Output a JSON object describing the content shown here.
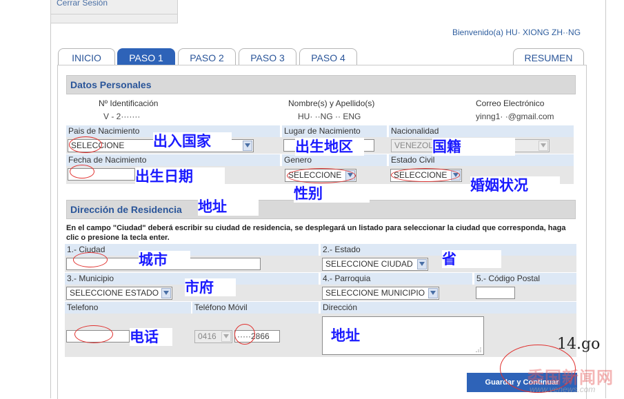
{
  "session": {
    "logout_link": "Cerrar Sesión"
  },
  "header": {
    "welcome": "Bienvenido(a) HU· XIONG ZH··NG"
  },
  "tabs": [
    {
      "label": "INICIO",
      "active": false
    },
    {
      "label": "PASO 1",
      "active": true
    },
    {
      "label": "PASO 2",
      "active": false
    },
    {
      "label": "PASO 3",
      "active": false
    },
    {
      "label": "PASO 4",
      "active": false
    },
    {
      "label": "RESUMEN",
      "active": false
    }
  ],
  "personal": {
    "section_title": "Datos Personales",
    "id_label": "Nº Identificación",
    "id_value": "V - 2·······",
    "name_label": "Nombre(s) y Apellido(s)",
    "name_value": "HU· ··NG ·· ENG",
    "email_label": "Correo Electrónico",
    "email_value": "yinng1· ·@gmail.com",
    "birth_country_label": "Pais de Nacimiento",
    "birth_country_value": "SELECCIONE",
    "birth_place_label": "Lugar de Nacimiento",
    "nationality_label": "Nacionalidad",
    "nationality_value": "VENEZOL",
    "birth_date_label": "Fecha de Nacimiento",
    "gender_label": "Genero",
    "gender_value": "SELECCIONE",
    "civil_label": "Estado Civil",
    "civil_value": "SELECCIONE"
  },
  "residence": {
    "section_title": "Dirección de Residencia",
    "note": "En el campo \"Ciudad\" deberá escribir su ciudad de residencia, se desplegará un listado para seleccionar la ciudad que corresponda, haga clic o presione la tecla enter.",
    "city_label": "1.- Ciudad",
    "state_label": "2.- Estado",
    "state_value": "SELECCIONE CIUDAD",
    "municipality_label": "3.- Municipio",
    "municipality_value": "SELECCIONE ESTADO",
    "parish_label": "4.- Parroquia",
    "parish_value": "SELECCIONE MUNICIPIO",
    "postal_label": "5.- Código Postal",
    "phone_label": "Telefono",
    "mobile_label": "Teléfono Móvil",
    "mobile_prefix": "0416",
    "mobile_value": "·····2866",
    "address_label": "Dirección"
  },
  "actions": {
    "continue_button": "Guardar y Continuar"
  },
  "annotations": {
    "birth_country": "出入国家",
    "birth_place": "出生地区",
    "nationality": "国籍",
    "birth_date": "出生日期",
    "gender": "性别",
    "civil": "婚姻状况",
    "address_section": "地址",
    "city": "城市",
    "state": "省",
    "municipality": "市府",
    "phone": "电话",
    "address": "地址",
    "step_number": "14.go"
  },
  "watermark": {
    "site": "委国新闻网",
    "url": "www.venews.com"
  },
  "colors": {
    "accent": "#2e63b8",
    "annotation_text": "#1a1aff",
    "annotation_circle": "#e0302e"
  }
}
